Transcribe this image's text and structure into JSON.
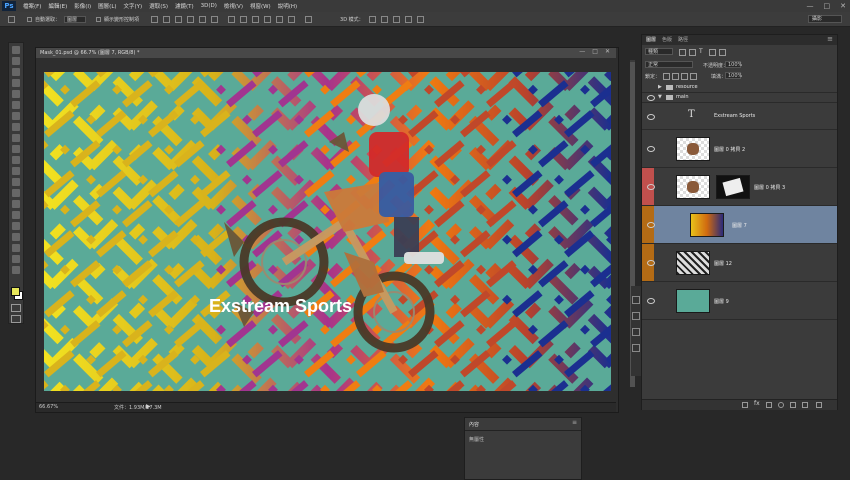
{
  "app": {
    "logo": "Ps"
  },
  "menu": [
    "檔案(F)",
    "編輯(E)",
    "影像(I)",
    "圖層(L)",
    "文字(Y)",
    "選取(S)",
    "濾鏡(T)",
    "3D(D)",
    "檢視(V)",
    "視窗(W)",
    "說明(H)"
  ],
  "window_controls": [
    "—",
    "□",
    "✕"
  ],
  "options_bar": {
    "auto_select_label": "自動選取：",
    "auto_select_value": "圖層",
    "show_transform_label": "顯示變形控制項",
    "mode_3d_label": "3D 模式：",
    "workspace": "攝影"
  },
  "document": {
    "tab_label": "Mask_01.psd @ 66.7% (圖層 7, RGB/8) *",
    "zoom": "66.67%",
    "doc_size": "文件：1.93M/17.3M",
    "canvas_text": "Exstream Sports"
  },
  "layers_panel": {
    "tabs": [
      "圖層",
      "色版",
      "路徑"
    ],
    "filter_kind": "種類",
    "blend_mode": "正常",
    "opacity_label": "不透明度：",
    "opacity_value": "100%",
    "lock_label": "鎖定：",
    "fill_label": "填滿：",
    "fill_value": "100%",
    "groups": [
      {
        "name": "resource"
      },
      {
        "name": "main"
      }
    ],
    "layers": [
      {
        "name": "Exstream Sports",
        "kind": "text"
      },
      {
        "name": "圖層 0 拷貝 2",
        "kind": "image"
      },
      {
        "name": "圖層 0 拷貝 3",
        "kind": "masked",
        "swatch_color": "#c0504d"
      },
      {
        "name": "圖層 7",
        "kind": "gradient",
        "swatch_color": "#b36b15",
        "selected": true
      },
      {
        "name": "圖層 12",
        "kind": "pattern",
        "swatch_color": "#b36b15"
      },
      {
        "name": "圖層 9",
        "kind": "fill",
        "fill_color": "#5aaa98"
      }
    ]
  },
  "properties_panel": {
    "title": "內容",
    "subtitle": "無屬性"
  },
  "colors": {
    "canvas_bg": "#5aaa98",
    "foreground": "#e8e85a",
    "background": "#ffffff",
    "selection": "#6f84a0"
  }
}
